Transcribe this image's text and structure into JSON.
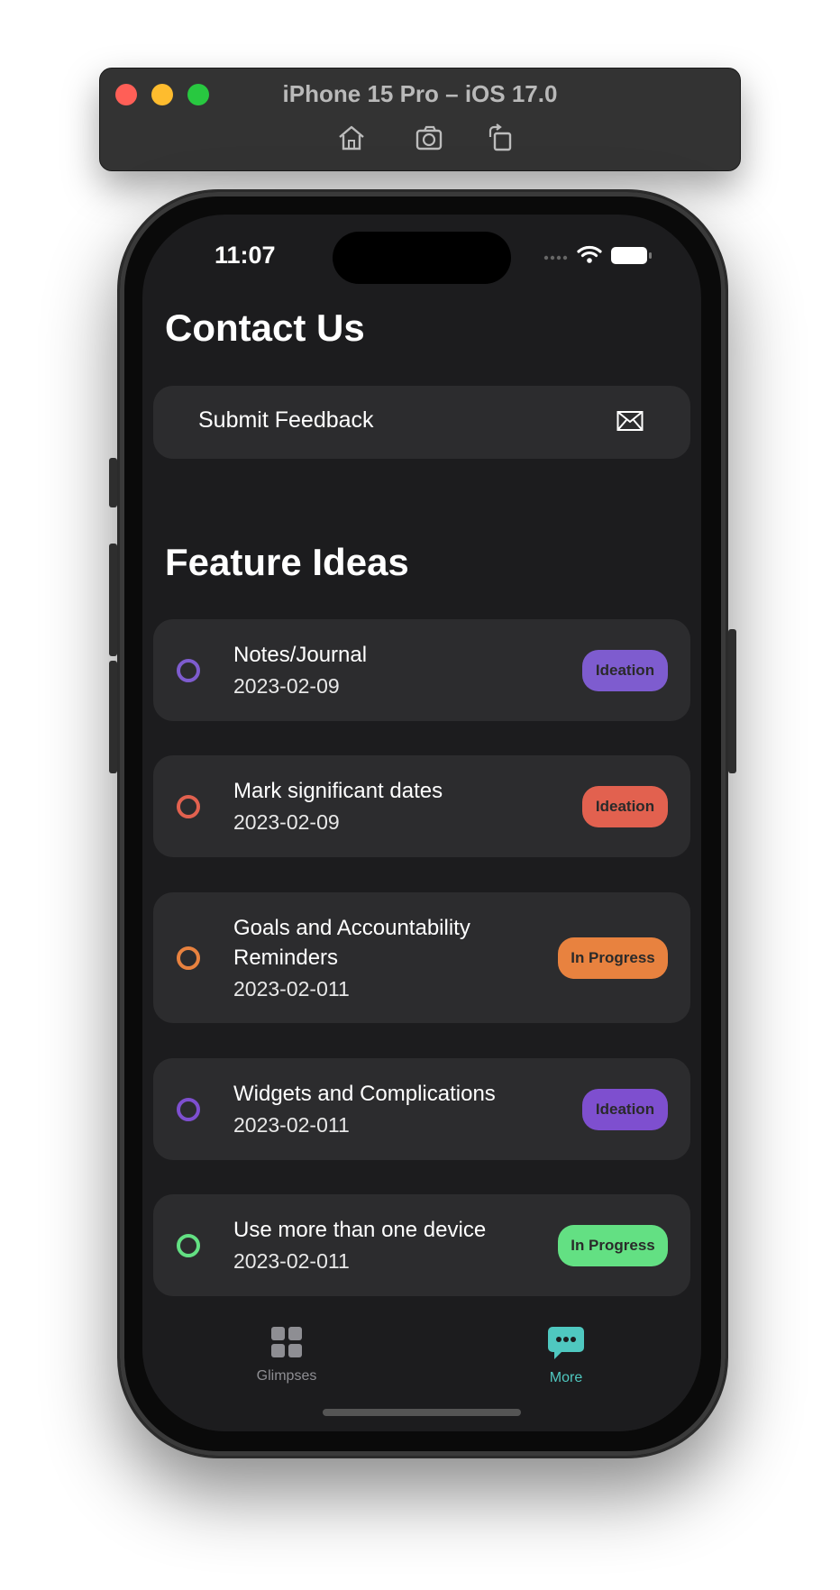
{
  "simulator": {
    "title": "iPhone 15 Pro – iOS 17.0",
    "tools": [
      "home-icon",
      "screenshot-icon",
      "rotate-icon"
    ]
  },
  "status_bar": {
    "time": "11:07"
  },
  "contact": {
    "heading": "Contact Us",
    "feedback_label": "Submit Feedback",
    "feedback_icon": "envelope-icon"
  },
  "features": {
    "heading": "Feature Ideas",
    "items": [
      {
        "title": "Notes/Journal",
        "date": "2023-02-09",
        "status": "Ideation",
        "color": "#7e5ccf"
      },
      {
        "title": "Mark significant dates",
        "date": "2023-02-09",
        "status": "Ideation",
        "color": "#e2614f"
      },
      {
        "title": "Goals and Accountability Reminders",
        "date": "2023-02-011",
        "status": "In Progress",
        "color": "#e8823f"
      },
      {
        "title": "Widgets and Complications",
        "date": "2023-02-011",
        "status": "Ideation",
        "color": "#7e4fcf"
      },
      {
        "title": "Use more than one device",
        "date": "2023-02-011",
        "status": "In Progress",
        "color": "#63e083"
      }
    ]
  },
  "tab_bar": {
    "tabs": [
      {
        "label": "Glimpses",
        "icon": "grid-icon",
        "active": false
      },
      {
        "label": "More",
        "icon": "chat-bubble-icon",
        "active": true
      }
    ],
    "active_color": "#4fc8c0",
    "inactive_color": "#8e8e93"
  }
}
